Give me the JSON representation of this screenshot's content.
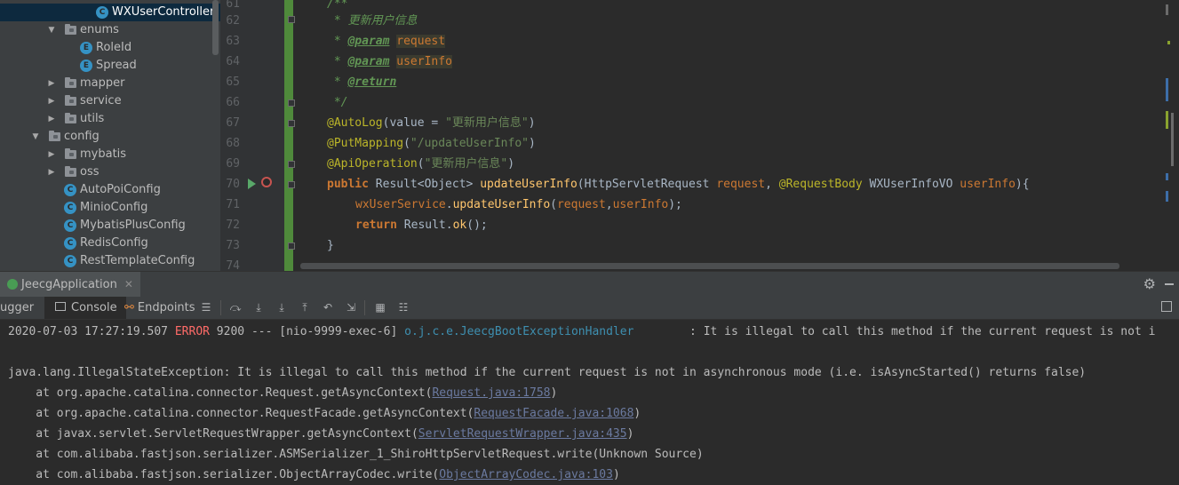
{
  "tree": {
    "items": [
      {
        "label": "WXUserController",
        "kind": "class",
        "icon": "C",
        "selected": true
      },
      {
        "label": "enums",
        "kind": "folder",
        "expanded": true
      },
      {
        "label": "RoleId",
        "kind": "enum",
        "icon": "E"
      },
      {
        "label": "Spread",
        "kind": "enum",
        "icon": "E"
      },
      {
        "label": "mapper",
        "kind": "folder",
        "expanded": false
      },
      {
        "label": "service",
        "kind": "folder",
        "expanded": false
      },
      {
        "label": "utils",
        "kind": "folder",
        "expanded": false
      },
      {
        "label": "config",
        "kind": "folder",
        "expanded": true
      },
      {
        "label": "mybatis",
        "kind": "folder",
        "expanded": false
      },
      {
        "label": "oss",
        "kind": "folder",
        "expanded": false
      },
      {
        "label": "AutoPoiConfig",
        "kind": "class",
        "icon": "C"
      },
      {
        "label": "MinioConfig",
        "kind": "class",
        "icon": "C"
      },
      {
        "label": "MybatisPlusConfig",
        "kind": "class",
        "icon": "C"
      },
      {
        "label": "RedisConfig",
        "kind": "class",
        "icon": "C"
      },
      {
        "label": "RestTemplateConfig",
        "kind": "class",
        "icon": "C"
      }
    ]
  },
  "editor": {
    "line_numbers": [
      "61",
      "62",
      "63",
      "64",
      "65",
      "66",
      "67",
      "68",
      "69",
      "70",
      "71",
      "72",
      "73",
      "74"
    ],
    "code": {
      "l61": "/**",
      "l62": " * 更新用户信息",
      "l63_star": " * ",
      "l63_tag": "@param",
      "l63_name": "request",
      "l64_star": " * ",
      "l64_tag": "@param",
      "l64_name": "userInfo",
      "l65_star": " * ",
      "l65_tag": "@return",
      "l66": " */",
      "l67_ann": "@AutoLog",
      "l67_open": "(value = ",
      "l67_str": "\"更新用户信息\"",
      "l67_close": ")",
      "l68_ann": "@PutMapping",
      "l68_open": "(",
      "l68_str": "\"/updateUserInfo\"",
      "l68_close": ")",
      "l69_ann": "@ApiOperation",
      "l69_open": "(",
      "l69_str": "\"更新用户信息\"",
      "l69_close": ")",
      "l70_kw": "public",
      "l70_type": " Result<Object> ",
      "l70_fn": "updateUserInfo",
      "l70_p1": "(HttpServletRequest ",
      "l70_p1n": "request",
      "l70_sep": ", ",
      "l70_ann": "@RequestBody",
      "l70_p2": " WXUserInfoVO ",
      "l70_p2n": "userInfo",
      "l70_end": "){",
      "l71_field": "wxUserService",
      "l71_dot": ".",
      "l71_method": "updateUserInfo",
      "l71_open": "(",
      "l71_a1": "request",
      "l71_comma": ",",
      "l71_a2": "userInfo",
      "l71_close": ");",
      "l72_kw": "return",
      "l72_mid": " Result.",
      "l72_method": "ok",
      "l72_end": "();",
      "l73": "}"
    }
  },
  "run_panel": {
    "tab_label": "JeecgApplication",
    "tab_close": "✕",
    "tabs": {
      "debugger": "ugger",
      "console": "Console",
      "endpoints": "Endpoints"
    }
  },
  "console": {
    "line1": {
      "timestamp": "2020-07-03 17:27:19.507 ",
      "level": "ERROR",
      "pid": " 9200 --- [nio-9999-exec-6] ",
      "logger": "o.j.c.e.JeecgBootExceptionHandler",
      "msg": "        : It is illegal to call this method if the current request is not i"
    },
    "line3": "java.lang.IllegalStateException: It is illegal to call this method if the current request is not in asynchronous mode (i.e. isAsyncStarted() returns false)",
    "stack": [
      {
        "prefix": "    at org.apache.catalina.connector.Request.getAsyncContext(",
        "link": "Request.java:1758",
        "suffix": ")"
      },
      {
        "prefix": "    at org.apache.catalina.connector.RequestFacade.getAsyncContext(",
        "link": "RequestFacade.java:1068",
        "suffix": ")"
      },
      {
        "prefix": "    at javax.servlet.ServletRequestWrapper.getAsyncContext(",
        "link": "ServletRequestWrapper.java:435",
        "suffix": ")"
      },
      {
        "prefix": "    at com.alibaba.fastjson.serializer.ASMSerializer_1_ShiroHttpServletRequest.write(Unknown Source)",
        "link": "",
        "suffix": ""
      },
      {
        "prefix": "    at com.alibaba.fastjson.serializer.ObjectArrayCodec.write(",
        "link": "ObjectArrayCodec.java:103",
        "suffix": ")"
      }
    ]
  },
  "colors": {
    "tree_bg": "#3c3f41",
    "selected_bg": "#0d293e",
    "editor_bg": "#2b2b2b",
    "vcs_added": "#4f8a3b",
    "error_red": "#ff6b68",
    "class_icon": "#3592c4"
  }
}
